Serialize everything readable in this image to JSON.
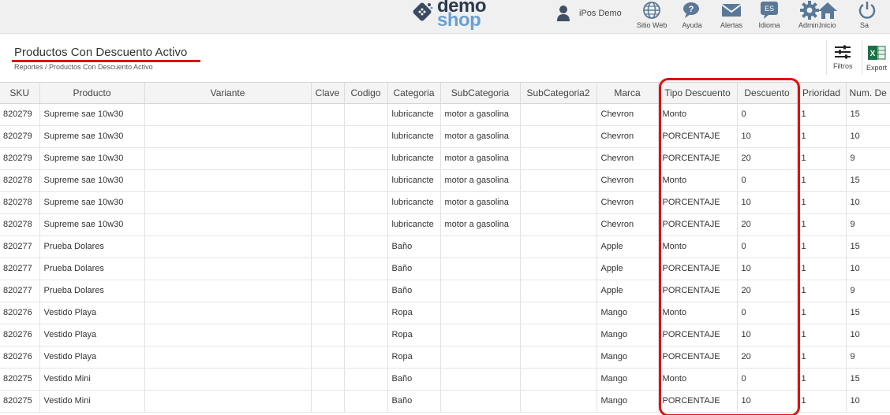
{
  "brand": {
    "line1": "demo",
    "line2": "shop"
  },
  "user": {
    "name": "iPos Demo"
  },
  "nav": [
    {
      "key": "web",
      "label": "Sitio Web",
      "icon": "globe-icon"
    },
    {
      "key": "help",
      "label": "Ayuda",
      "icon": "help-chat-icon"
    },
    {
      "key": "alerts",
      "label": "Alertas",
      "icon": "envelope-icon"
    },
    {
      "key": "lang",
      "label": "Idioma",
      "icon": "language-icon",
      "badge": "ES"
    },
    {
      "key": "admin",
      "label": "Admin.",
      "icon": "gear-icon"
    },
    {
      "key": "home",
      "label": "Inicio",
      "icon": "home-icon"
    },
    {
      "key": "exit",
      "label": "Sa",
      "icon": "power-icon"
    }
  ],
  "page": {
    "title": "Productos Con Descuento Activo",
    "breadcrumb": "Reportes / Productos Con Descuento Activo"
  },
  "toolbar": {
    "filters_label": "Filtros",
    "export_label": "Export"
  },
  "table": {
    "columns": [
      "SKU",
      "Producto",
      "Variante",
      "Clave",
      "Codigo",
      "Categoria",
      "SubCategoria",
      "SubCategoria2",
      "Marca",
      "Tipo Descuento",
      "Descuento",
      "Prioridad",
      "Num. De"
    ],
    "rows": [
      [
        "820279",
        "Supreme sae 10w30",
        "",
        "",
        "",
        "lubricancte",
        "motor a gasolina",
        "",
        "Chevron",
        "Monto",
        "0",
        "1",
        "15"
      ],
      [
        "820279",
        "Supreme sae 10w30",
        "",
        "",
        "",
        "lubricancte",
        "motor a gasolina",
        "",
        "Chevron",
        "PORCENTAJE",
        "10",
        "1",
        "10"
      ],
      [
        "820279",
        "Supreme sae 10w30",
        "",
        "",
        "",
        "lubricancte",
        "motor a gasolina",
        "",
        "Chevron",
        "PORCENTAJE",
        "20",
        "1",
        "9"
      ],
      [
        "820278",
        "Supreme sae 10w30",
        "",
        "",
        "",
        "lubricancte",
        "motor a gasolina",
        "",
        "Chevron",
        "Monto",
        "0",
        "1",
        "15"
      ],
      [
        "820278",
        "Supreme sae 10w30",
        "",
        "",
        "",
        "lubricancte",
        "motor a gasolina",
        "",
        "Chevron",
        "PORCENTAJE",
        "10",
        "1",
        "10"
      ],
      [
        "820278",
        "Supreme sae 10w30",
        "",
        "",
        "",
        "lubricancte",
        "motor a gasolina",
        "",
        "Chevron",
        "PORCENTAJE",
        "20",
        "1",
        "9"
      ],
      [
        "820277",
        "Prueba Dolares",
        "",
        "",
        "",
        "Baño",
        "",
        "",
        "Apple",
        "Monto",
        "0",
        "1",
        "15"
      ],
      [
        "820277",
        "Prueba Dolares",
        "",
        "",
        "",
        "Baño",
        "",
        "",
        "Apple",
        "PORCENTAJE",
        "10",
        "1",
        "10"
      ],
      [
        "820277",
        "Prueba Dolares",
        "",
        "",
        "",
        "Baño",
        "",
        "",
        "Apple",
        "PORCENTAJE",
        "20",
        "1",
        "9"
      ],
      [
        "820276",
        "Vestido Playa",
        "",
        "",
        "",
        "Ropa",
        "",
        "",
        "Mango",
        "Monto",
        "0",
        "1",
        "15"
      ],
      [
        "820276",
        "Vestido Playa",
        "",
        "",
        "",
        "Ropa",
        "",
        "",
        "Mango",
        "PORCENTAJE",
        "10",
        "1",
        "10"
      ],
      [
        "820276",
        "Vestido Playa",
        "",
        "",
        "",
        "Ropa",
        "",
        "",
        "Mango",
        "PORCENTAJE",
        "20",
        "1",
        "9"
      ],
      [
        "820275",
        "Vestido Mini",
        "",
        "",
        "",
        "Baño",
        "",
        "",
        "Mango",
        "Monto",
        "0",
        "1",
        "15"
      ],
      [
        "820275",
        "Vestido Mini",
        "",
        "",
        "",
        "Baño",
        "",
        "",
        "Mango",
        "PORCENTAJE",
        "10",
        "1",
        "10"
      ]
    ]
  },
  "colors": {
    "annotation_red": "#e01010",
    "brand_dark": "#2c3a4f",
    "brand_light": "#6a9fd3",
    "icon_blue": "#5a7897"
  }
}
